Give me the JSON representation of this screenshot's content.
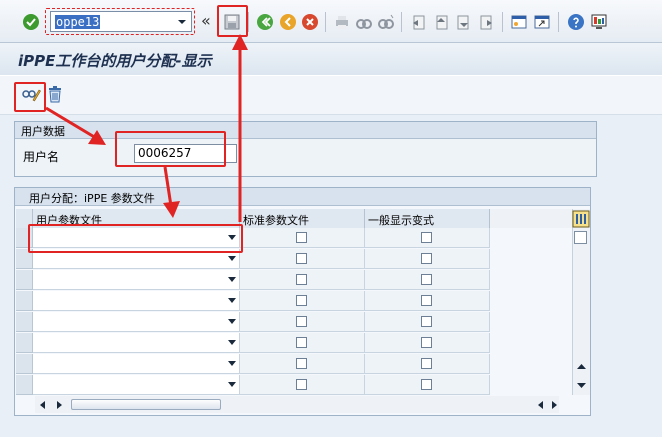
{
  "toolbar": {
    "command_field_value": "oppe13",
    "icons": [
      "enter-icon",
      "dropdown-icon",
      "nav-back-arrows-icon",
      "save-icon",
      "back-icon",
      "exit-icon",
      "cancel-icon",
      "print-icon",
      "find-icon",
      "find-next-icon",
      "first-page-icon",
      "prev-page-icon",
      "next-page-icon",
      "last-page-icon",
      "new-session-icon",
      "shortcut-icon",
      "help-icon",
      "layout-icon"
    ],
    "overflow_glyph": "«"
  },
  "title": "iPPE工作台的用户分配-显示",
  "app_toolbar": {
    "icons": [
      "display-change-icon",
      "delete-icon"
    ]
  },
  "user_group": {
    "title": "用户数据",
    "user_label": "用户名",
    "user_value": "0006257"
  },
  "table_group": {
    "title": "用户分配：iPPE 参数文件",
    "columns": [
      "用户参数文件",
      "标准参数文件",
      "一般显示变式"
    ],
    "row_count": 8
  },
  "colors": {
    "annotation_red": "#e02424",
    "header_bg": "#d7e2ee"
  }
}
